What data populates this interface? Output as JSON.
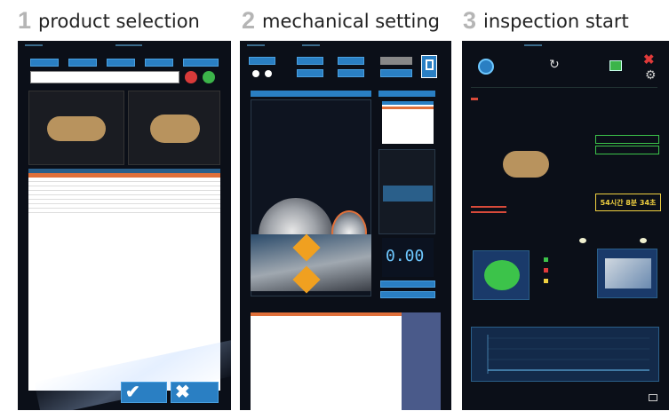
{
  "steps": [
    {
      "num": "1",
      "title": "product selection"
    },
    {
      "num": "2",
      "title": "mechanical setting"
    },
    {
      "num": "3",
      "title": "inspection start"
    }
  ],
  "panel3": {
    "timer": "54시간 8분 34초"
  },
  "mech": {
    "readout": "0.00"
  },
  "colors": {
    "panel_bg": "#0b0f18",
    "accent_blue": "#2a7fc3",
    "table_selected": "#e0703a",
    "ok_green": "#3cc34a",
    "warn_red": "#e03a3a",
    "timer_yellow": "#f0d040"
  },
  "icons": {
    "confirm": "check-icon",
    "cancel": "x-icon",
    "settings": "gear-icon",
    "close": "close-icon",
    "refresh": "refresh-icon"
  }
}
